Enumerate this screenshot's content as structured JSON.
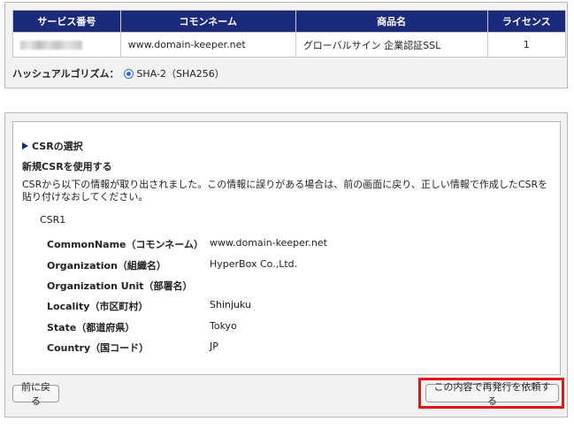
{
  "service_table": {
    "headers": [
      "サービス番号",
      "コモンネーム",
      "商品名",
      "ライセンス"
    ],
    "row": {
      "common_name": "www.domain-keeper.net",
      "product": "グローバルサイン 企業認証SSL",
      "license": "1"
    }
  },
  "hash": {
    "label": "ハッシュアルゴリズム：",
    "option": "SHA-2（SHA256）"
  },
  "csr": {
    "section_title": "CSRの選択",
    "subtitle": "新規CSRを使用する",
    "description": "CSRから以下の情報が取り出されました。この情報に誤りがある場合は、前の画面に戻り、正しい情報で作成したCSRを貼り付けなおしてください。",
    "csr_label": "CSR1",
    "fields": [
      {
        "key": "CommonName（コモンネーム）",
        "value": "www.domain-keeper.net"
      },
      {
        "key": "Organization（組織名）",
        "value": "HyperBox Co.,Ltd."
      },
      {
        "key": "Organization Unit（部署名）",
        "value": ""
      },
      {
        "key": "Locality（市区町村）",
        "value": "Shinjuku"
      },
      {
        "key": "State（都道府県）",
        "value": "Tokyo"
      },
      {
        "key": "Country（国コード）",
        "value": "JP"
      }
    ]
  },
  "buttons": {
    "back": "前に戻る",
    "submit": "この内容で再発行を依頼する"
  },
  "colors": {
    "header_bg": "#1c2a7a",
    "highlight": "#e8141c"
  }
}
